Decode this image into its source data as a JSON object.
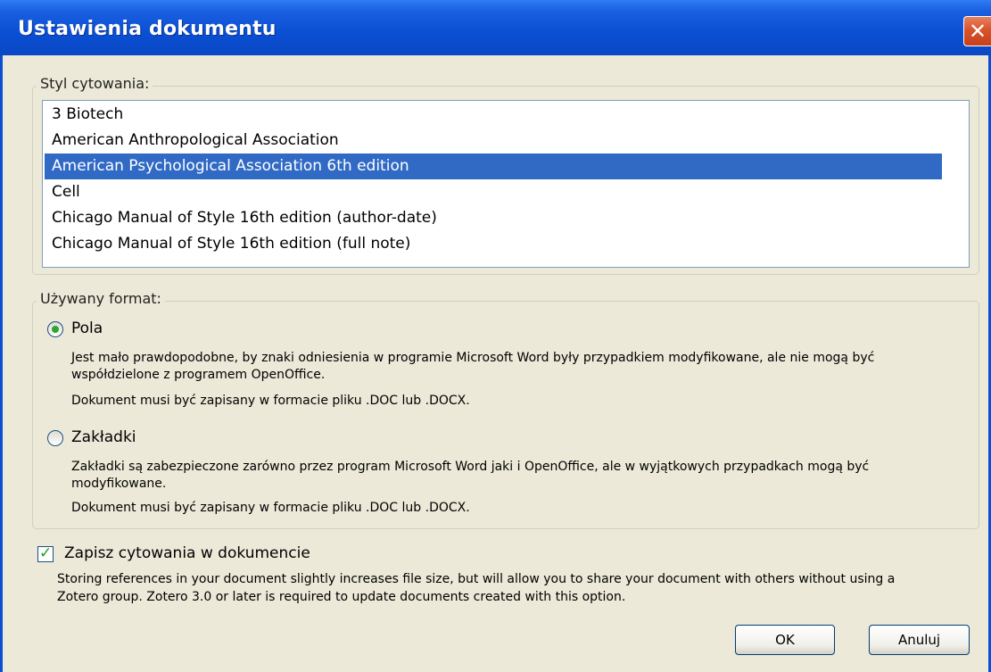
{
  "window": {
    "title": "Ustawienia dokumentu",
    "close_icon": "close-x-icon"
  },
  "citation_style": {
    "label": "Styl cytowania:",
    "items": [
      "3 Biotech",
      "American Anthropological Association",
      "American Psychological Association 6th edition",
      "Cell",
      "Chicago Manual of Style 16th edition (author-date)",
      "Chicago Manual of Style 16th edition (full note)"
    ],
    "selected_index": 2
  },
  "format": {
    "label": "Używany format:",
    "options": [
      {
        "label": "Pola",
        "checked": true,
        "desc1": "Jest mało prawdopodobne, by znaki odniesienia w programie Microsoft Word były przypadkiem modyfikowane, ale nie mogą być",
        "desc2": "współdzielone z programem OpenOffice.",
        "desc3": "Dokument musi być zapisany w formacie pliku .DOC lub .DOCX."
      },
      {
        "label": "Zakładki",
        "checked": false,
        "desc1": "Zakładki są zabezpieczone zarówno przez program Microsoft Word jaki i OpenOffice, ale w wyjątkowych przypadkach mogą być",
        "desc2": "modyfikowane.",
        "desc3": "Dokument musi być zapisany w formacie pliku .DOC lub .DOCX."
      }
    ]
  },
  "store_citations": {
    "label": "Zapisz cytowania w dokumencie",
    "checked": true,
    "desc1": "Storing references in your document slightly increases file size, but will allow you to share your document with others without using a",
    "desc2": "Zotero group. Zotero 3.0 or later is required to update documents created with this option."
  },
  "buttons": {
    "ok": "OK",
    "cancel": "Anuluj"
  },
  "colors": {
    "title_bar": "#0a4fd3",
    "selection": "#316ac5",
    "dialog_bg": "#ece9d8",
    "radio_dot": "#2fa52f"
  }
}
